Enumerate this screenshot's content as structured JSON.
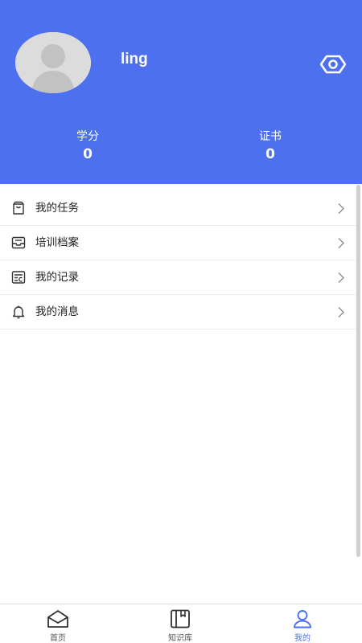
{
  "profile": {
    "username": "ling",
    "avatar_icon": "default-avatar-icon",
    "toggle_icon": "eye-icon"
  },
  "stats": [
    {
      "label": "学分",
      "value": "0"
    },
    {
      "label": "证书",
      "value": "0"
    }
  ],
  "menu": [
    {
      "label": "我的任务",
      "icon": "task-bag-icon"
    },
    {
      "label": "培训档案",
      "icon": "inbox-tray-icon"
    },
    {
      "label": "我的记录",
      "icon": "record-list-icon"
    },
    {
      "label": "我的消息",
      "icon": "bell-icon"
    }
  ],
  "tabs": [
    {
      "label": "首页",
      "icon": "home-icon",
      "active": false
    },
    {
      "label": "知识库",
      "icon": "book-icon",
      "active": false
    },
    {
      "label": "我的",
      "icon": "user-icon",
      "active": true
    }
  ],
  "colors": {
    "primary": "#4d70ef",
    "header_text": "#ffffff",
    "menu_text": "#222222",
    "tab_inactive": "#555555"
  }
}
